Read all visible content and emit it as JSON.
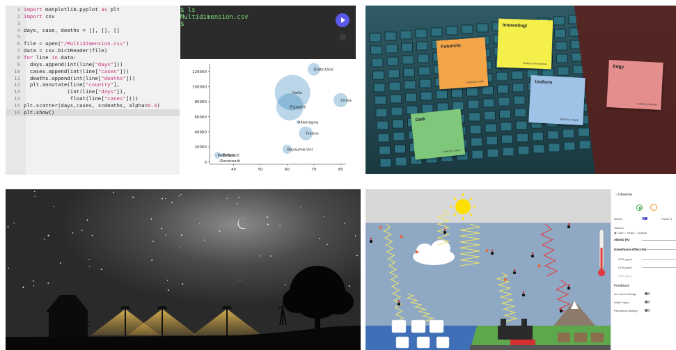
{
  "editor": {
    "lines": [
      {
        "n": "1",
        "text": "import matplotlib.pyplot as plt"
      },
      {
        "n": "2",
        "text": "import csv"
      },
      {
        "n": "3",
        "text": ""
      },
      {
        "n": "4",
        "text": "days, case, deaths = [], [], []"
      },
      {
        "n": "5",
        "text": ""
      },
      {
        "n": "6",
        "text": "file = open(\"/Multidimension.csv\")"
      },
      {
        "n": "7",
        "text": "data = csv.DictReader(file)"
      },
      {
        "n": "8",
        "text": "for line in data:"
      },
      {
        "n": "9",
        "text": "  days.append(int(line[\"days\"]))"
      },
      {
        "n": "10",
        "text": "  cases.append(int(line[\"cases\"]))"
      },
      {
        "n": "11",
        "text": "  deaths.append(int(line[\"deaths\"]))"
      },
      {
        "n": "12",
        "text": "  plt.annotate(line[\"country\"],"
      },
      {
        "n": "13",
        "text": "              (int(line[\"days\"]),"
      },
      {
        "n": "14",
        "text": "               float(line[\"cases\"])))"
      },
      {
        "n": "15",
        "text": "plt.scatter(days,cases, s=deaths, alpha=0.3)"
      },
      {
        "n": "16",
        "text": "plt.show()"
      }
    ],
    "active_line": 16
  },
  "terminal": {
    "lines": [
      "$ ls",
      "Multidimension.csv",
      "$"
    ]
  },
  "chart_data": {
    "type": "scatter",
    "xlim": [
      31,
      82
    ],
    "ylim": [
      -3000,
      130000
    ],
    "x_ticks": [
      40,
      50,
      60,
      70,
      80
    ],
    "y_ticks": [
      0,
      20000,
      40000,
      60000,
      80000,
      100000,
      120000
    ],
    "y_tick_labels": [
      "0",
      "20000",
      "40000",
      "60000",
      "80000",
      "100000",
      "120000"
    ],
    "points": [
      {
        "label": "Etats-Unis",
        "x": 70,
        "y": 123000,
        "size": 3.0
      },
      {
        "label": "Italie",
        "x": 62,
        "y": 92000,
        "size": 8.5
      },
      {
        "label": "Espagne",
        "x": 61,
        "y": 73000,
        "size": 6.5
      },
      {
        "label": "Chine",
        "x": 80,
        "y": 82000,
        "size": 3.4
      },
      {
        "label": "Allemagne",
        "x": 64,
        "y": 53000,
        "size": 0.8
      },
      {
        "label": "France",
        "x": 67,
        "y": 38000,
        "size": 3.3
      },
      {
        "label": "Royaume-Uni",
        "x": 60,
        "y": 17000,
        "size": 2.2
      },
      {
        "label": "Pays-Bas",
        "x": 34,
        "y": 9000,
        "size": 1.6
      },
      {
        "label": "Danemark",
        "x": 35,
        "y": 1500,
        "size": 0.5
      },
      {
        "label": "Belgique",
        "x": 36,
        "y": 9500,
        "size": 0.9
      }
    ]
  },
  "sticky": {
    "notes": [
      {
        "title": "Futuristic",
        "footer": "Added by Andre",
        "color": "#f3a548"
      },
      {
        "title": "Interesting!",
        "footer": "Added by Anonymous",
        "color": "#f4ef4a"
      },
      {
        "title": "Uniform",
        "footer": "Added by Caspar",
        "color": "#9fc2e7"
      },
      {
        "title": "Edgy",
        "footer": "Added by Pamela",
        "color": "#e58e8e"
      },
      {
        "title": "Dark",
        "footer": "Added by Julian",
        "color": "#7fc87b"
      }
    ]
  },
  "sim": {
    "observe_label": "Observe",
    "waves_label": "Waves",
    "pause_label": "Pause S",
    "values_label": "Values in",
    "radio": [
      "1900",
      "Today",
      "Custom"
    ],
    "albedo_label": "Albedo (%)",
    "greenhouse_label": "Greenhouse Effect (%)",
    "co2_label": "CO2 (ppm)",
    "ch4_label": "CH4 (ppm)",
    "n2o_label": "N2O (ppm)",
    "feedback_label": "Feedback",
    "feedback_items": [
      "Ice Cover Change",
      "Water Vapor",
      "Permafrost Melting"
    ],
    "colors": {
      "sky": "#8fa9c4",
      "water": "#3f6fb6",
      "sun": "#ffe000",
      "wave_yellow": "#efe56a",
      "wave_red": "#e23a3a",
      "accent": "#5a58e8"
    }
  }
}
